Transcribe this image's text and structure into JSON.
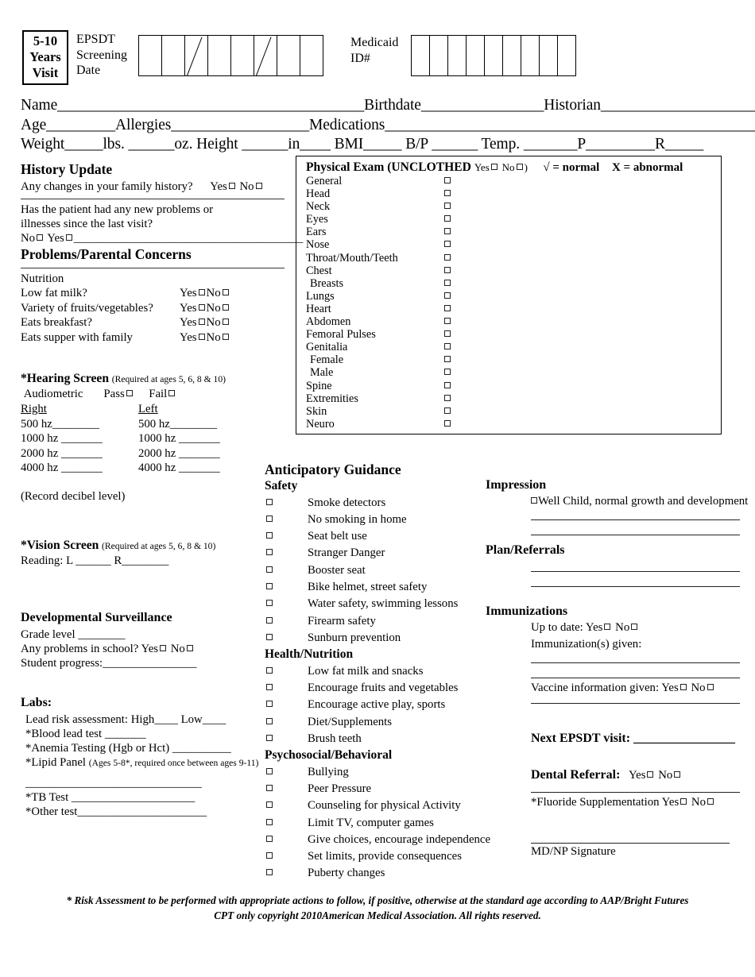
{
  "header": {
    "visit_box": [
      "5-10",
      "Years",
      "Visit"
    ],
    "epsdt_label": [
      "EPSDT",
      "Screening",
      "Date"
    ],
    "date_boxes": 8,
    "date_slash_positions": [
      2,
      5
    ],
    "medicaid_label": [
      "Medicaid",
      "ID#"
    ],
    "medicaid_boxes": 9
  },
  "demographics": {
    "line1": "Name________________________________________Birthdate________________Historian______________________",
    "line2": "Age_________Allergies__________________Medications_________________________________________________",
    "line3": "Weight_____lbs. ______oz.  Height ______in____        BMI_____   B/P ______   Temp. _______P_________R_____"
  },
  "history": {
    "title": "History Update",
    "family_history_q": "Any changes in your family history?",
    "yes": "Yes",
    "no": "No",
    "new_problems_q1": "Has the patient had any new problems or",
    "new_problems_q2": "illnesses since the last visit?",
    "answer_prefix_no": "No",
    "answer_prefix_yes": "Yes",
    "answer_line": "_______________________________________"
  },
  "problems": {
    "title": "Problems/Parental Concerns",
    "nutrition_label": "Nutrition",
    "items": [
      {
        "q": "Low fat milk?"
      },
      {
        "q": "Variety of fruits/vegetables?"
      },
      {
        "q": "Eats breakfast?"
      },
      {
        "q": "Eats supper with family"
      }
    ]
  },
  "hearing": {
    "title": "*Hearing Screen",
    "note": "(Required at ages 5, 6, 8 & 10)",
    "audiometric": "Audiometric",
    "pass": "Pass",
    "fail": "Fail",
    "right_label": "Right",
    "left_label": "Left",
    "right_rows": [
      "500 hz________",
      "1000 hz _______",
      "2000 hz _______",
      "4000 hz _______"
    ],
    "left_rows": [
      "500 hz________",
      "1000 hz _______",
      "2000 hz _______",
      "4000 hz _______"
    ],
    "record_note": "(Record decibel level)"
  },
  "vision": {
    "title": "*Vision Screen",
    "note": "(Required at ages 5, 6, 8 & 10)",
    "reading": "Reading:  L ______          R________"
  },
  "development": {
    "title": "Developmental Surveillance",
    "grade_level": "Grade level ________",
    "problems_q": "Any problems in school?",
    "yes": "Yes",
    "no": "No",
    "progress": "Student progress:________________"
  },
  "labs": {
    "title": "Labs:",
    "lead_risk": "Lead risk assessment: High____ Low____",
    "blood_lead": "*Blood lead test _______",
    "anemia": "*Anemia Testing (Hgb or Hct) __________",
    "lipid_panel": "*Lipid Panel",
    "lipid_note": "(Ages 5-8*, required once between ages 9-11)",
    "blank_line": "______________________________",
    "tb_test": "*TB Test _____________________",
    "other_test": "*Other test______________________"
  },
  "physical_exam": {
    "title": "Physical Exam (UNCLOTHED",
    "yes": "Yes",
    "no": "No",
    "close_paren": ")",
    "normal_key": "√ = normal",
    "abnormal_key": "X = abnormal",
    "rows": [
      {
        "name": "General",
        "indent": false
      },
      {
        "name": "Head",
        "indent": false
      },
      {
        "name": "Neck",
        "indent": false
      },
      {
        "name": "Eyes",
        "indent": false
      },
      {
        "name": "Ears",
        "indent": false
      },
      {
        "name": "Nose",
        "indent": false
      },
      {
        "name": "Throat/Mouth/Teeth",
        "indent": false
      },
      {
        "name": "Chest",
        "indent": false
      },
      {
        "name": "Breasts",
        "indent": true
      },
      {
        "name": "Lungs",
        "indent": false
      },
      {
        "name": "Heart",
        "indent": false
      },
      {
        "name": "Abdomen",
        "indent": false
      },
      {
        "name": "Femoral Pulses",
        "indent": false
      },
      {
        "name": "Genitalia",
        "indent": false
      },
      {
        "name": "Female",
        "indent": true
      },
      {
        "name": "Male",
        "indent": true
      },
      {
        "name": "Spine",
        "indent": false
      },
      {
        "name": "Extremities",
        "indent": false
      },
      {
        "name": "Skin",
        "indent": false
      },
      {
        "name": "Neuro",
        "indent": false
      }
    ]
  },
  "anticipatory_guidance": {
    "title": "Anticipatory Guidance",
    "groups": [
      {
        "heading": "Safety",
        "items": [
          "Smoke detectors",
          "No smoking in home",
          "Seat belt use",
          "Stranger Danger",
          "Booster seat",
          "Bike helmet, street safety",
          "Water safety, swimming lessons",
          "Firearm safety",
          "Sunburn prevention"
        ]
      },
      {
        "heading": "Health/Nutrition",
        "items": [
          "Low fat milk and snacks",
          "Encourage fruits and vegetables",
          "Encourage active play, sports",
          "Diet/Supplements",
          "Brush teeth"
        ]
      },
      {
        "heading": "Psychosocial/Behavioral",
        "items": [
          "Bullying",
          "Peer Pressure",
          "Counseling for physical Activity",
          "Limit TV, computer games",
          "Give choices, encourage independence",
          "Set limits, provide consequences",
          "Puberty changes"
        ]
      }
    ]
  },
  "impression": {
    "heading": "Impression",
    "well_child": "Well Child, normal growth and development"
  },
  "plan": {
    "heading": "Plan/Referrals"
  },
  "immunizations": {
    "heading": "Immunizations",
    "up_to_date": "Up to date:  Yes",
    "no": "No",
    "given": "Immunization(s) given:",
    "vaccine_info": "Vaccine information given: Yes",
    "vaccine_no": "No"
  },
  "next_visit": {
    "label": "Next EPSDT visit:  ________________"
  },
  "dental": {
    "label": "Dental Referral:",
    "yes": "Yes",
    "no": "No"
  },
  "fluoride": {
    "label": "*Fluoride Supplementation Yes",
    "no": "No"
  },
  "signature": {
    "label": "MD/NP Signature"
  },
  "footer": {
    "line1": "* Risk Assessment to be performed with appropriate actions to follow, if positive, otherwise at the standard age according to AAP/Bright Futures",
    "line2": "CPT only copyright 2010American Medical Association.  All rights reserved."
  }
}
